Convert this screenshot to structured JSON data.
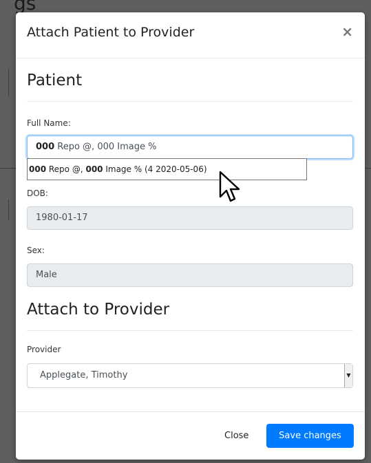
{
  "background": {
    "title_fragment": "gs"
  },
  "modal": {
    "title": "Attach Patient to Provider",
    "close_symbol": "×",
    "patient_section_title": "Patient",
    "full_name_label": "Full Name:",
    "full_name_value_bold": "000",
    "full_name_value_rest": " Repo @, 000 Image %",
    "suggestion": {
      "part1": "000",
      "part2": " Repo @, ",
      "part3": "000",
      "part4": " Image % (4 2020-05-06)"
    },
    "dob_label": "DOB:",
    "dob_value": "1980-01-17",
    "sex_label": "Sex:",
    "sex_value": "Male",
    "provider_section_title": "Attach to Provider",
    "provider_label": "Provider",
    "provider_selected": "Applegate, Timothy",
    "close_button": "Close",
    "save_button": "Save changes"
  },
  "colors": {
    "primary": "#007bff",
    "focus": "#80bdff",
    "readonly_bg": "#e9ecef"
  },
  "icons": {
    "cursor": "mouse-pointer-icon",
    "select_arrow": "caret-down-icon"
  }
}
